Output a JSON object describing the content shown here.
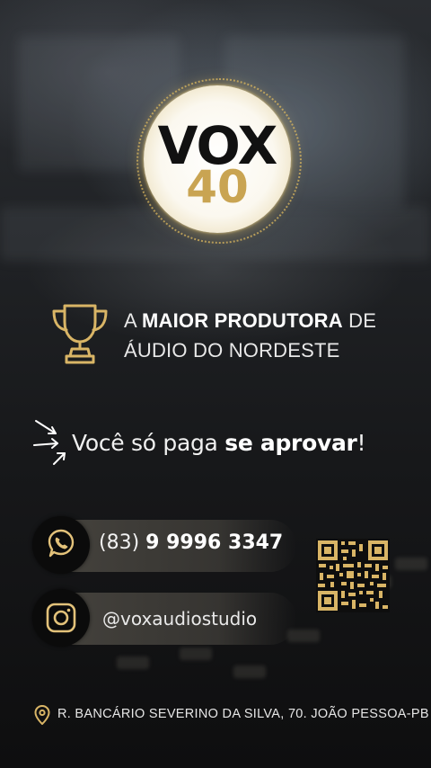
{
  "logo": {
    "brand": "VOX",
    "number": "40"
  },
  "tagline": {
    "prefix": "A ",
    "highlight": "MAIOR PRODUTORA",
    "suffix": " DE",
    "line2": "ÁUDIO DO NORDESTE"
  },
  "approve": {
    "prefix": "Você só paga ",
    "highlight": "se aprovar",
    "suffix": "!"
  },
  "phone": {
    "area": "(83) ",
    "number": "9 9996 3347"
  },
  "instagram": {
    "handle": "@voxaudiostudio"
  },
  "address": {
    "text": "R. BANCÁRIO SEVERINO DA SILVA, 70. JOÃO PESSOA-PB"
  },
  "colors": {
    "gold": "#c9a452",
    "gold_light": "#e3c27a",
    "dark": "#0b0b0b"
  },
  "icons": [
    "trophy-icon",
    "arrows-icon",
    "whatsapp-icon",
    "instagram-icon",
    "qr-code-icon",
    "location-pin-icon"
  ]
}
